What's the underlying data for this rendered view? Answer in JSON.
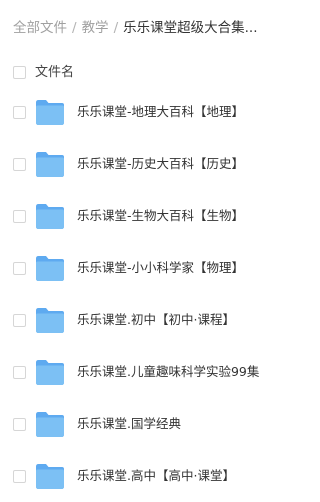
{
  "breadcrumb": {
    "items": [
      "全部文件",
      "教学"
    ],
    "separator": "/",
    "current": "乐乐课堂超级大合集..."
  },
  "list_header": {
    "name_column": "文件名"
  },
  "files": [
    {
      "name": "乐乐课堂-地理大百科【地理】",
      "icon": "folder-icon"
    },
    {
      "name": "乐乐课堂-历史大百科【历史】",
      "icon": "folder-icon"
    },
    {
      "name": "乐乐课堂-生物大百科【生物】",
      "icon": "folder-icon"
    },
    {
      "name": "乐乐课堂-小小科学家【物理】",
      "icon": "folder-icon"
    },
    {
      "name": "乐乐课堂.初中【初中·课程】",
      "icon": "folder-icon"
    },
    {
      "name": "乐乐课堂.儿童趣味科学实验99集",
      "icon": "folder-icon"
    },
    {
      "name": "乐乐课堂.国学经典",
      "icon": "folder-icon"
    },
    {
      "name": "乐乐课堂.高中【高中·课堂】",
      "icon": "folder-icon"
    }
  ],
  "colors": {
    "folder_front": "#7cc0f4",
    "folder_back": "#5eaaf0",
    "breadcrumb_link": "#a0a0a0",
    "text": "#333333"
  }
}
